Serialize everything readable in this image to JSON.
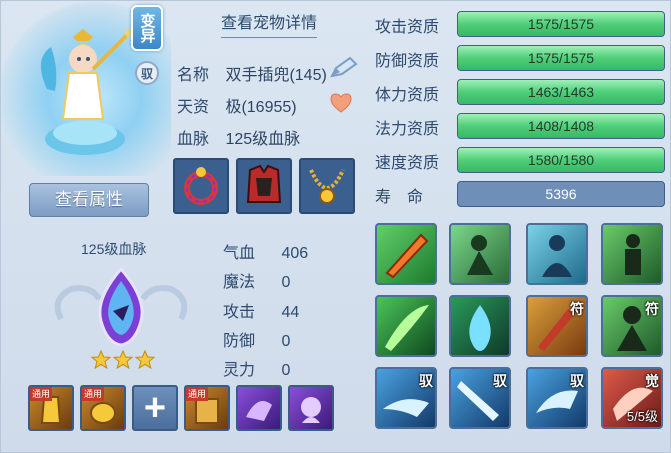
{
  "pet": {
    "variant_badge": "变异",
    "yu_badge": "驭",
    "view_attributes_button": "查看属性"
  },
  "detail": {
    "title": "查看宠物详情",
    "name_label": "名称",
    "name_value": "双手插兜(145)",
    "talent_label": "天资",
    "talent_value": "极(16955)",
    "bloodline_label": "血脉",
    "bloodline_value": "125级血脉"
  },
  "equipment": [
    {
      "icon": "ring-icon"
    },
    {
      "icon": "armor-icon"
    },
    {
      "icon": "necklace-icon"
    }
  ],
  "bloodline_panel": {
    "title": "125级血脉",
    "stars": 3
  },
  "stats": {
    "hp_label": "气血",
    "hp_value": "406",
    "mp_label": "魔法",
    "mp_value": "0",
    "atk_label": "攻击",
    "atk_value": "44",
    "def_label": "防御",
    "def_value": "0",
    "spirit_label": "灵力",
    "spirit_value": "0"
  },
  "bottom_skills": [
    {
      "tag": "通用",
      "icon": "gold-statue-icon"
    },
    {
      "tag": "通用",
      "icon": "gold-pot-icon"
    },
    {
      "tag": "",
      "icon": "add-icon"
    },
    {
      "tag": "通用",
      "icon": "book-icon"
    },
    {
      "tag": "",
      "icon": "purple-beast-icon"
    },
    {
      "tag": "",
      "icon": "purple-spirit-icon"
    }
  ],
  "aptitudes": [
    {
      "label": "攻击资质",
      "value": "1575/1575",
      "fill": 1.0
    },
    {
      "label": "防御资质",
      "value": "1575/1575",
      "fill": 1.0
    },
    {
      "label": "体力资质",
      "value": "1463/1463",
      "fill": 1.0
    },
    {
      "label": "法力资质",
      "value": "1408/1408",
      "fill": 1.0
    },
    {
      "label": "速度资质",
      "value": "1580/1580",
      "fill": 1.0
    }
  ],
  "lifespan": {
    "label": "寿　命",
    "value": "5396"
  },
  "skill_grid": [
    {
      "icon": "fire-sword-icon",
      "badge": "",
      "level": ""
    },
    {
      "icon": "green-shadow-icon",
      "badge": "",
      "level": ""
    },
    {
      "icon": "blue-figure-icon",
      "badge": "",
      "level": ""
    },
    {
      "icon": "green-warrior-icon",
      "badge": "",
      "level": ""
    },
    {
      "icon": "green-slash-icon",
      "badge": "",
      "level": ""
    },
    {
      "icon": "blue-flame-icon",
      "badge": "",
      "level": ""
    },
    {
      "icon": "gold-talisman-icon",
      "badge": "符",
      "level": ""
    },
    {
      "icon": "green-monk-icon",
      "badge": "符",
      "level": ""
    },
    {
      "icon": "blue-dash-icon",
      "badge": "驭",
      "level": ""
    },
    {
      "icon": "blue-blade-icon",
      "badge": "驭",
      "level": ""
    },
    {
      "icon": "blue-beast-icon",
      "badge": "驭",
      "level": ""
    },
    {
      "icon": "red-awaken-icon",
      "badge": "觉",
      "level": "5/5级"
    }
  ],
  "colors": {
    "bar_fill": "#4fcf7a",
    "bar_bg": "#6f8fb9",
    "text": "#2e4a6e"
  }
}
